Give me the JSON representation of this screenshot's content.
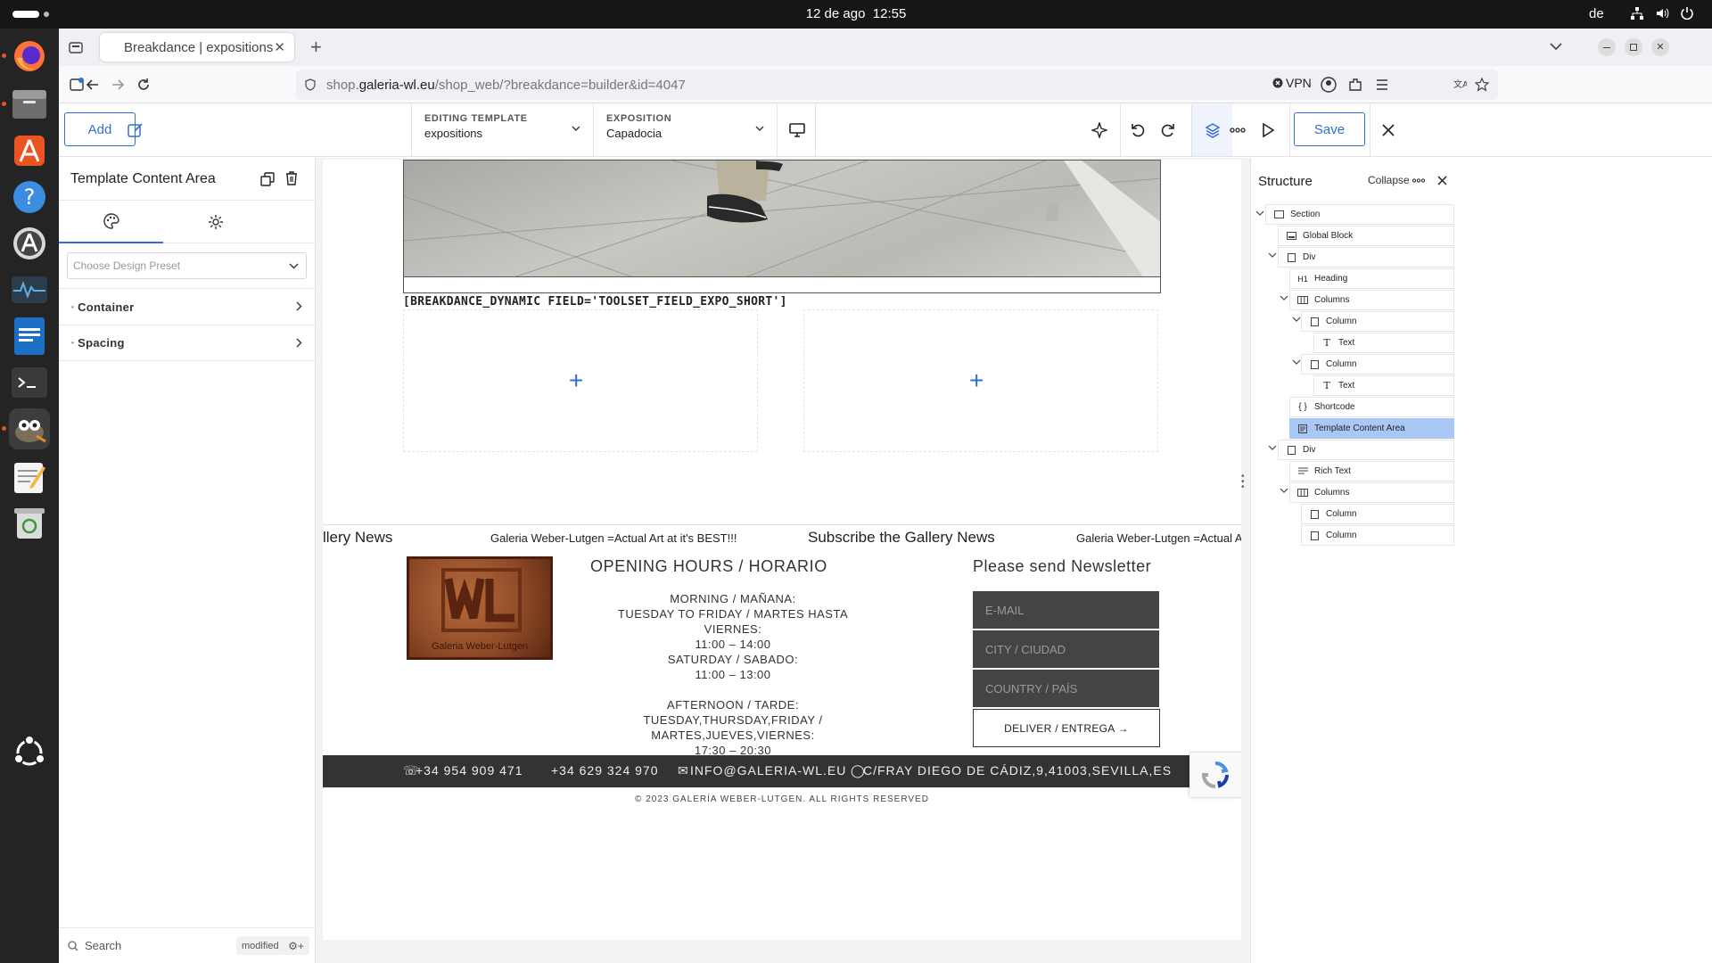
{
  "os": {
    "date": "12 de ago",
    "time": "12:55",
    "lang": "de"
  },
  "browser": {
    "tab_title": "Breakdance | expositions",
    "url_prefix": "shop.",
    "url_domain": "galeria-wl.eu",
    "url_path": "/shop_web/?breakdance=builder&id=4047",
    "vpn": "VPN"
  },
  "toolbar": {
    "add_label": "Add",
    "editing_template_label": "EDITING TEMPLATE",
    "editing_template_value": "expositions",
    "exposition_label": "EXPOSITION",
    "exposition_value": "Capadocia",
    "save_label": "Save"
  },
  "left_panel": {
    "title": "Template Content Area",
    "preset_placeholder": "Choose Design Preset",
    "sections": [
      "Container",
      "Spacing"
    ],
    "search_placeholder": "Search",
    "modified_badge": "modified",
    "plus": "+"
  },
  "canvas": {
    "shortcode": "[BREAKDANCE_DYNAMIC FIELD='TOOLSET_FIELD_EXPO_SHORT']",
    "marquee_left": "llery News",
    "marquee_text1": "Galeria Weber-Lutgen  =Actual Art at it's BEST!!!",
    "marquee_mid": "Subscribe the Gallery News",
    "marquee_text2": "Galeria Weber-Lutgen  =Actual Art at",
    "logo_text": "Galeria Weber-Lutgen",
    "hours_title": "OPENING HOURS / HORARIO",
    "hours_lines": [
      "MORNING / MAÑANA:",
      "TUESDAY TO FRIDAY / MARTES HASTA VIERNES:",
      "11:00 – 14:00",
      "SATURDAY / SABADO:",
      "11:00 – 13:00",
      "",
      "AFTERNOON / TARDE:",
      "TUESDAY,THURSDAY,FRIDAY / MARTES,JUEVES,VIERNES:",
      "17:30 – 20:30"
    ],
    "newsletter_title": "Please send Newsletter",
    "email_placeholder": "E-MAIL",
    "city_placeholder": "CITY / CIUDAD",
    "country_placeholder": "COUNTRY / PAÍS",
    "deliver_label": "DELIVER / ENTREGA →",
    "phone1": "+34 954 909 471",
    "phone2": "+34 629 324 970",
    "email": "INFO@GALERIA-WL.EU",
    "address": "C/FRAY DIEGO DE CÁDIZ,9,41003,SEVILLA,ES",
    "copyright": "© 2023 GALERÍA WEBER-LUTGEN. ALL RIGHTS RESERVED"
  },
  "structure": {
    "title": "Structure",
    "collapse_label": "Collapse",
    "nodes": [
      {
        "label": "Section",
        "icon": "section-icon"
      },
      {
        "label": "Global Block",
        "icon": "global-block-icon"
      },
      {
        "label": "Div",
        "icon": "div-icon"
      },
      {
        "label": "Heading",
        "icon": "heading-icon",
        "prefix": "H1"
      },
      {
        "label": "Columns",
        "icon": "columns-icon"
      },
      {
        "label": "Column",
        "icon": "column-icon"
      },
      {
        "label": "Text",
        "icon": "text-icon"
      },
      {
        "label": "Column",
        "icon": "column-icon"
      },
      {
        "label": "Text",
        "icon": "text-icon"
      },
      {
        "label": "Shortcode",
        "icon": "shortcode-icon"
      },
      {
        "label": "Template Content Area",
        "icon": "template-icon",
        "selected": true
      },
      {
        "label": "Div",
        "icon": "div-icon"
      },
      {
        "label": "Rich Text",
        "icon": "rich-text-icon"
      },
      {
        "label": "Columns",
        "icon": "columns-icon"
      },
      {
        "label": "Column",
        "icon": "column-icon"
      },
      {
        "label": "Column",
        "icon": "column-icon"
      }
    ]
  },
  "colors": {
    "accent": "#2f6fd6",
    "selected_node": "#a9c8f5",
    "footer_bar": "#333333"
  }
}
